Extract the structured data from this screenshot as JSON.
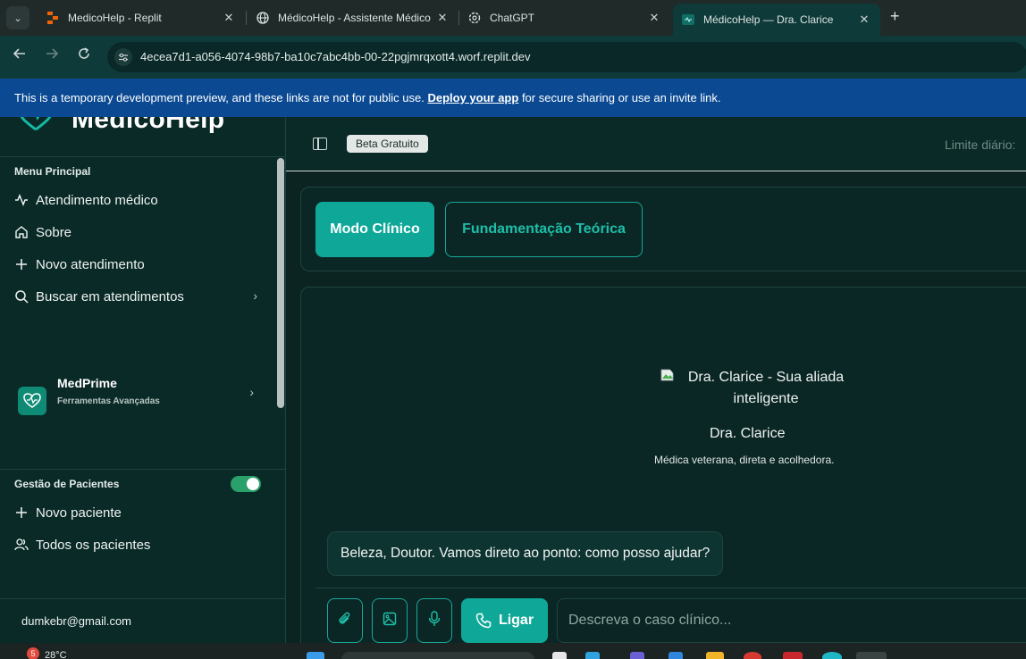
{
  "browser": {
    "tabs": [
      {
        "title": "MedicoHelp - Replit",
        "icon": "replit-icon"
      },
      {
        "title": "MédicoHelp - Assistente Médico",
        "icon": "globe-icon"
      },
      {
        "title": "ChatGPT",
        "icon": "chatgpt-icon"
      },
      {
        "title": "MédicoHelp — Dra. Clarice",
        "icon": "medicohelp-favicon"
      }
    ],
    "close_glyph": "✕",
    "new_tab_glyph": "+",
    "url": "4ecea7d1-a056-4074-98b7-ba10c7abc4bb-00-22pgjmrqxott4.worf.replit.dev"
  },
  "banner": {
    "prefix": "This is a temporary development preview, and these links are not for public use. ",
    "link": "Deploy your app",
    "suffix": " for secure sharing or use an invite link."
  },
  "sidebar": {
    "logo_text": "MedicoHelp",
    "menu_title": "Menu Principal",
    "items": [
      {
        "label": "Atendimento médico",
        "icon": "activity-icon"
      },
      {
        "label": "Sobre",
        "icon": "home-icon"
      },
      {
        "label": "Novo atendimento",
        "icon": "plus-icon"
      },
      {
        "label": "Buscar em atendimentos",
        "icon": "search-icon"
      }
    ],
    "chevron": "›",
    "medprime": {
      "name": "MedPrime",
      "subtitle": "Ferramentas Avançadas"
    },
    "patients_title": "Gestão de Pacientes",
    "patients_toggle_on": true,
    "patients_items": [
      {
        "label": "Novo paciente",
        "icon": "plus-icon"
      },
      {
        "label": "Todos os pacientes",
        "icon": "users-icon"
      }
    ],
    "user_email": "dumkebr@gmail.com"
  },
  "main": {
    "beta_badge": "Beta Gratuito",
    "daily_limit": "Limite diário: ",
    "modes": [
      {
        "label": "Modo Clínico",
        "active": true
      },
      {
        "label": "Fundamentação Teórica",
        "active": false
      }
    ],
    "assistant": {
      "avatar_alt": "Dra. Clarice - Sua aliada inteligente",
      "name": "Dra. Clarice",
      "description": "Médica veterana, direta e acolhedora."
    },
    "messages": [
      {
        "role": "assistant",
        "text": "Beleza, Doutor. Vamos direto ao ponto: como posso ajudar?"
      }
    ],
    "composer": {
      "call_label": "Ligar",
      "placeholder": "Descreva o caso clínico...",
      "value": ""
    }
  },
  "taskbar": {
    "weather_badge": "5",
    "temperature": "28°C"
  },
  "colors": {
    "accent": "#0fa898",
    "banner": "#0b4a93",
    "sidebar_bg": "#0a2a27",
    "toggle_on": "#2aa16b"
  }
}
